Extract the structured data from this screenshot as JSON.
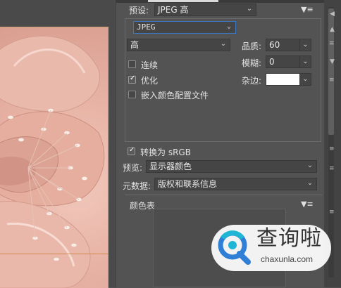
{
  "preset": {
    "label": "预设:",
    "value": "JPEG 高"
  },
  "format": {
    "value": "JPEG"
  },
  "quality_level": {
    "value": "高"
  },
  "quality": {
    "label": "品质:",
    "value": "60"
  },
  "blur": {
    "label": "模糊:",
    "value": "0"
  },
  "matte": {
    "label": "杂边:",
    "color": "#ffffff"
  },
  "options": [
    {
      "label": "连续",
      "checked": false
    },
    {
      "label": "优化",
      "checked": true
    },
    {
      "label": "嵌入颜色配置文件",
      "checked": false
    }
  ],
  "convert_srgb": {
    "label": "转换为 sRGB",
    "checked": true
  },
  "preview": {
    "label": "预览:",
    "value": "显示器颜色"
  },
  "metadata": {
    "label": "元数据:",
    "value": "版权和联系信息"
  },
  "color_table": {
    "title": "颜色表"
  },
  "watermark": {
    "cn": "查询啦",
    "en": "chaxunla.com"
  },
  "colors": {
    "panel_bg": "#535353",
    "input_bg": "#454545",
    "accent_focus": "#3a78c4",
    "guide": "#d08a4a",
    "logo_blue": "#2f7fd6",
    "logo_cyan": "#1fb5d4"
  }
}
